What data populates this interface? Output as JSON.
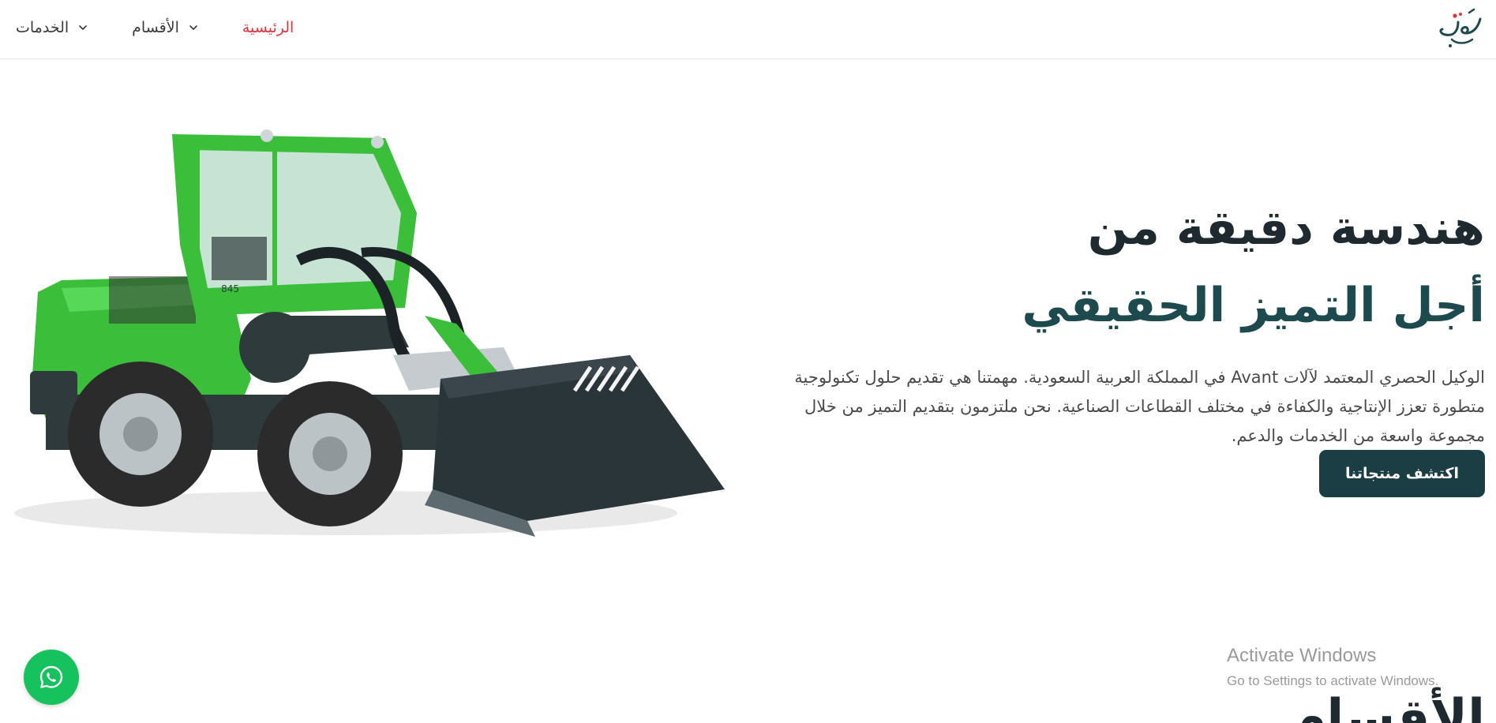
{
  "header": {
    "logo": {
      "icon": "arabic-calligraphy-logo",
      "text": "رؤى"
    },
    "nav": [
      {
        "label": "الرئيسية",
        "active": true,
        "has_dropdown": false
      },
      {
        "label": "الأقسام",
        "active": false,
        "has_dropdown": true
      },
      {
        "label": "الخدمات",
        "active": false,
        "has_dropdown": true
      }
    ],
    "active_color": "#e2343c"
  },
  "hero": {
    "title_line1": "هندسة دقيقة من",
    "title_line2": "أجل التميز الحقيقي",
    "description": "الوكيل الحصري المعتمد لآلات Avant في المملكة العربية السعودية. مهمتنا هي تقديم حلول تكنولوجية متطورة تعزز الإنتاجية والكفاءة في مختلف القطاعات الصناعية. نحن ملتزمون بتقديم التميز من خلال مجموعة واسعة من الخدمات والدعم.",
    "cta_label": "اكتشف منتجاتنا",
    "image": {
      "subject": "green Avant 845 compact loader with bucket",
      "model_marking": "845"
    },
    "accent_color": "#1b3d44"
  },
  "next_section": {
    "title": "الأقسام"
  },
  "whatsapp": {
    "icon": "whatsapp-icon",
    "color": "#16c25e"
  },
  "os_watermark": {
    "title": "Activate Windows",
    "subtitle": "Go to Settings to activate Windows."
  }
}
